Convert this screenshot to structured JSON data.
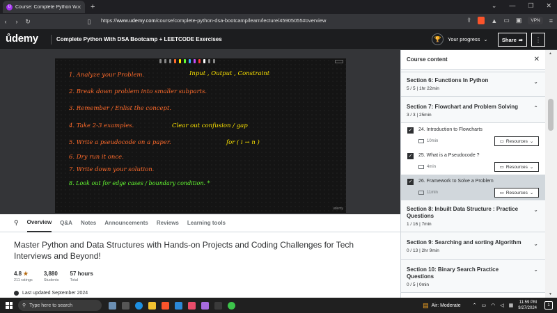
{
  "browser": {
    "tab_title": "Course: Complete Python W",
    "tab_favicon": "udemy-favicon",
    "new_tab": "+",
    "window_controls": [
      "⌄",
      "—",
      "❐",
      "✕"
    ],
    "url_prefix": "https://",
    "url_host": "www.udemy.com",
    "url_path": "/course/complete-python-dsa-bootcamp/learn/lecture/45905055#overview",
    "vpn_label": "VPN"
  },
  "header": {
    "logo": "ůdemy",
    "course_title": "Complete Python With DSA Bootcamp + LEETCODE Exercises",
    "progress_label": "Your progress",
    "share_label": "Share",
    "more_label": "⋮"
  },
  "board": {
    "watermark": "udemy",
    "lines": [
      {
        "text": "1.  Analyze  your  Problem.",
        "color": "#ff6b2b"
      },
      {
        "text": "Input , Output , Constraint",
        "color": "#ffe600"
      },
      {
        "text": "2.  Break  down  problem  into  smaller  subparts.",
        "color": "#ff6b2b"
      },
      {
        "text": "3.  Remember / Enlist  the  concept.",
        "color": "#ff6b2b"
      },
      {
        "text": "4.  Take  2-3  examples.",
        "color": "#ff6b2b"
      },
      {
        "text": "Clear  out  confusion / gap",
        "color": "#ffe600"
      },
      {
        "text": "5.  Write  a  pseudocode  on  a  paper.",
        "color": "#ff6b2b"
      },
      {
        "text": "for ( i → n )",
        "color": "#ffe600"
      },
      {
        "text": "6.  Dry  run  it  once.",
        "color": "#ff6b2b"
      },
      {
        "text": "7.  Write  down  your  solution.",
        "color": "#ff6b2b"
      },
      {
        "text": "8.  Look  out  for  edge  cases / boundary  condition.  *",
        "color": "#66ff33"
      }
    ]
  },
  "sidebar": {
    "title": "Course content",
    "close": "✕",
    "sections": [
      {
        "title": "Section 6: Functions In Python",
        "meta": "5 / 5 | 1hr 22min",
        "chevron": "⌄"
      },
      {
        "title": "Section 7: Flowchart and Problem Solving",
        "meta": "3 / 3 | 25min",
        "chevron": "⌃"
      },
      {
        "title": "Section 8: Inbuilt Data Structure : Practice Questions",
        "meta": "1 / 16 | 7min",
        "chevron": "⌄"
      },
      {
        "title": "Section 9: Searching and sorting Algorithm",
        "meta": "0 / 13 | 2hr 9min",
        "chevron": "⌄"
      },
      {
        "title": "Section 10: Binary Search Practice Questions",
        "meta": "0 / 5 | 0min",
        "chevron": "⌄"
      }
    ],
    "lectures": [
      {
        "title": "24. Introduction to Flowcharts",
        "duration": "10min",
        "resources": "Resources"
      },
      {
        "title": "25. What is a Pseudocode ?",
        "duration": "4min",
        "resources": "Resources"
      },
      {
        "title": "26. Framework to Solve a Problem",
        "duration": "11min",
        "resources": "Resources"
      }
    ]
  },
  "below": {
    "tabs": [
      "Overview",
      "Q&A",
      "Notes",
      "Announcements",
      "Reviews",
      "Learning tools"
    ],
    "headline": "Master Python and Data Structures with Hands-on Projects and Coding Challenges for Tech Interviews and Beyond!",
    "rating": "4.8",
    "rating_label": "211 ratings",
    "students": "3,880",
    "students_label": "Students",
    "total": "57 hours",
    "total_label": "Total",
    "updated": "Last updated September 2024"
  },
  "taskbar": {
    "search_placeholder": "Type here to search",
    "air": "Air: Moderate",
    "time": "11:59 PM",
    "date": "9/27/2024",
    "notif_count": "1"
  },
  "colors": {
    "udemy_purple": "#a435f0",
    "header_bg": "#1c1d1f",
    "board_orange": "#ff6b2b",
    "board_yellow": "#ffe600",
    "board_green": "#66ff33"
  }
}
